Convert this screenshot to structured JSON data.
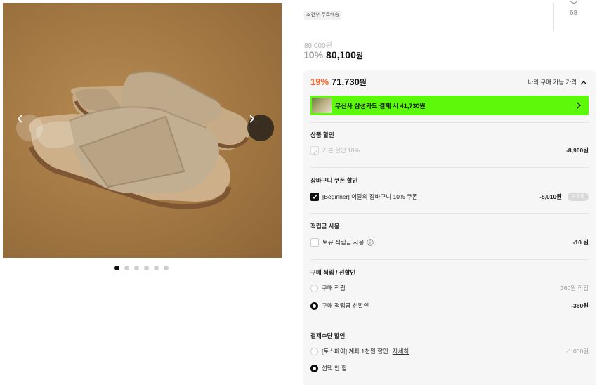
{
  "gallery": {
    "total_slides": 6,
    "active_slide": 1
  },
  "header": {
    "shipping_tag": "조건부 무료배송",
    "like_count": "68",
    "original_price": "89,000원",
    "discount_percent": "10%",
    "discount_price": "80,100",
    "won": "원"
  },
  "benefits": {
    "best_percent": "19%",
    "best_price": "71,730",
    "won": "원",
    "my_price_label": "나의 구매 가능 가격",
    "promo_text": "무신사 삼성카드 결제 시 41,730원",
    "sections": {
      "product_discount": {
        "title": "상품 할인",
        "item_label": "기본 할인 10%",
        "item_amount": "-8,900원"
      },
      "cart_coupon": {
        "title": "장바구니 쿠폰 할인",
        "item_label": "[Beginner] 이달의 장바구니 10% 쿠폰",
        "item_amount": "-8,010원",
        "badge": "보유중"
      },
      "points": {
        "title": "적립금 사용",
        "item_label": "보유 적립금 사용",
        "item_amount": "-10 원"
      },
      "purchase_points": {
        "title": "구매 적립 / 선할인",
        "option1_label": "구매 적립",
        "option1_amount": "360원 적립",
        "option2_label": "구매 적립금 선할인",
        "option2_amount": "-360원"
      },
      "payment": {
        "title": "결제수단 할인",
        "option1_label": "[토스페이] 계좌 1천원 할인",
        "option1_link": "자세히",
        "option1_amount": "-1,000원",
        "option2_label": "선택 안 함"
      }
    }
  },
  "colors": {
    "accent_orange": "#ff5a1f",
    "promo_green": "#5cfa0a",
    "panel_bg": "#f6f6f6"
  }
}
